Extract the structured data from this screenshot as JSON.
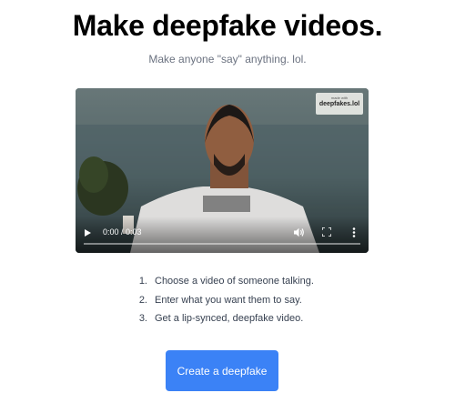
{
  "page": {
    "title": "Make deepfake videos.",
    "subtitle": "Make anyone \"say\" anything. lol."
  },
  "video": {
    "watermark_small": "made with",
    "watermark_big": "deepfakes.lol",
    "time": "0:00 / 0:03",
    "progress": 0,
    "icons": [
      "play-icon",
      "volume-icon",
      "fullscreen-icon",
      "more-options-icon"
    ]
  },
  "steps": [
    {
      "num": "1.",
      "text": "Choose a video of someone talking."
    },
    {
      "num": "2.",
      "text": "Enter what you want them to say."
    },
    {
      "num": "3.",
      "text": "Get a lip-synced, deepfake video."
    }
  ],
  "cta": {
    "label": "Create a deepfake",
    "color": "#3b82f6"
  }
}
